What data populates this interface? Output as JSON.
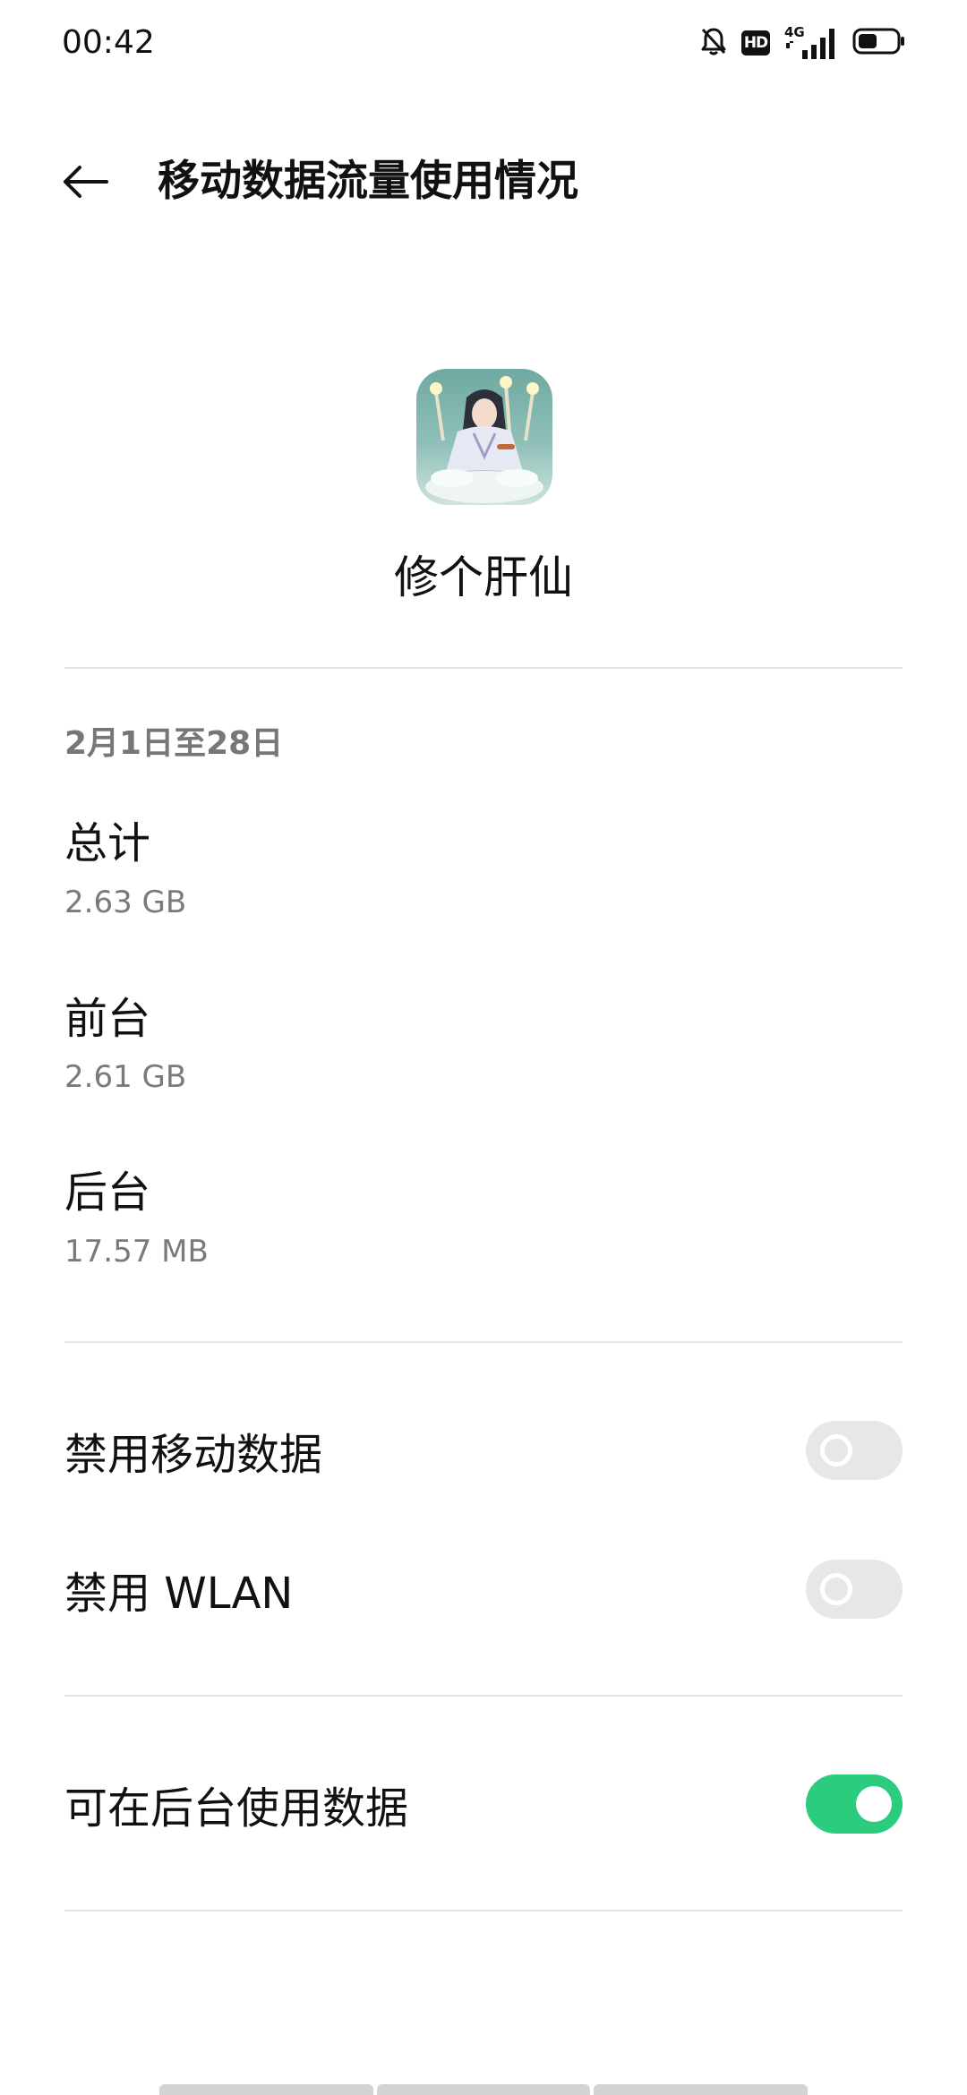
{
  "status_bar": {
    "time": "00:42",
    "icons": [
      "silent-bell-icon",
      "hd-icon",
      "signal-4g-icon",
      "battery-icon"
    ],
    "hd_label": "HD",
    "network_label": "4G"
  },
  "header": {
    "back_icon": "arrow-left-icon",
    "title": "移动数据流量使用情况"
  },
  "app": {
    "name": "修个肝仙"
  },
  "usage": {
    "period": "2月1日至28日",
    "items": [
      {
        "label": "总计",
        "value": "2.63 GB"
      },
      {
        "label": "前台",
        "value": "2.61 GB"
      },
      {
        "label": "后台",
        "value": "17.57 MB"
      }
    ]
  },
  "settings": {
    "disable_mobile_data": {
      "label": "禁用移动数据",
      "enabled": false
    },
    "disable_wlan": {
      "label": "禁用 WLAN",
      "enabled": false
    },
    "background_data": {
      "label": "可在后台使用数据",
      "enabled": true
    }
  },
  "colors": {
    "toggle_on": "#2bcc7d",
    "toggle_off": "#e7e7e7",
    "secondary_text": "#7a7a7a"
  }
}
